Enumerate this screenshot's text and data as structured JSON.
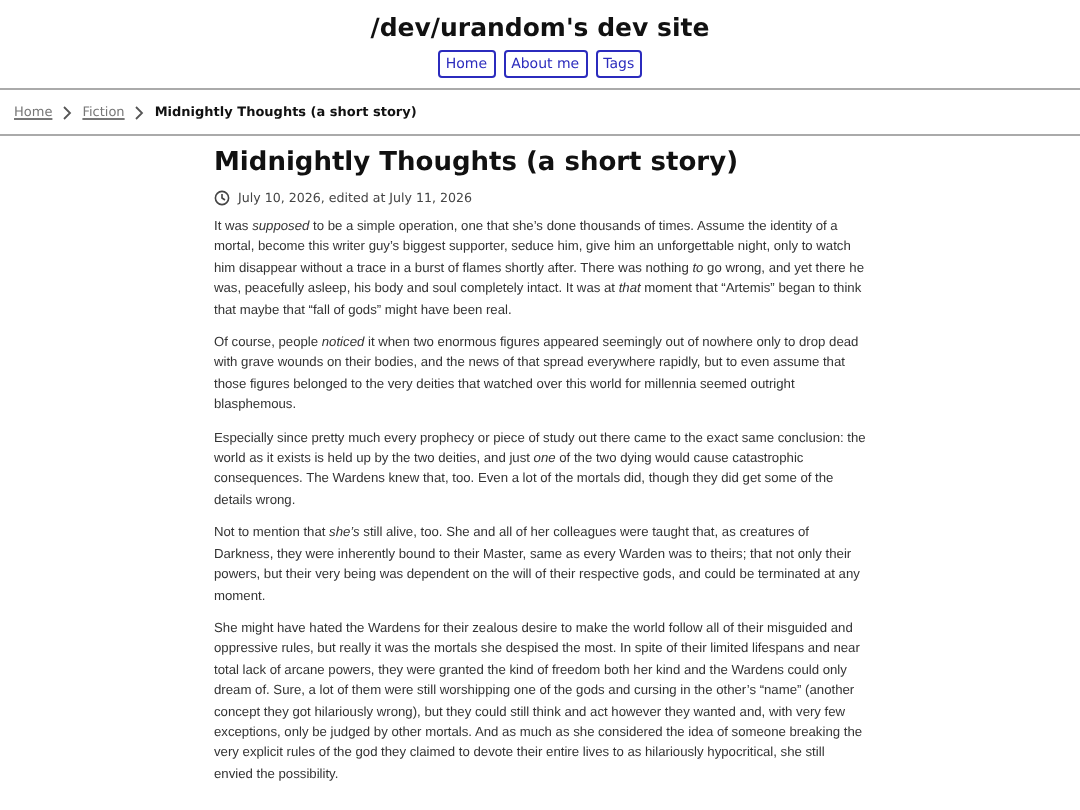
{
  "site_title": "/dev/urandom's dev site",
  "nav": [
    {
      "label": "Home"
    },
    {
      "label": "About me"
    },
    {
      "label": "Tags"
    }
  ],
  "breadcrumbs": [
    {
      "label": "Home",
      "kind": "link"
    },
    {
      "label": "Fiction",
      "kind": "link"
    },
    {
      "label": "Midnightly Thoughts (a short story)",
      "kind": "current"
    }
  ],
  "article": {
    "title": "Midnightly Thoughts (a short story)",
    "date": "July 10, 2026, edited at July 11, 2026",
    "paragraphs": [
      "It was *supposed* to be a simple operation, one that she’s done thousands of times. Assume the identity of a mortal, become this writer guy’s biggest supporter, seduce him, give him an unforgettable night, only to watch him disappear without a trace in a burst of flames shortly after. There was nothing *to* go wrong, and yet there he was, peacefully asleep, his body and soul completely intact. It was at *that* moment that “Artemis” began to think that maybe that “fall of gods” might have been real.",
      "Of course, people *noticed* it when two enormous figures appeared seemingly out of nowhere only to drop dead with grave wounds on their bodies, and the news of that spread everywhere rapidly, but to even assume that those figures belonged to the very deities that watched over this world for millennia seemed outright blasphemous.",
      "Especially since pretty much every prophecy or piece of study out there came to the exact same conclusion: the world as it exists is held up by the two deities, and just *one* of the two dying would cause catastrophic consequences. The Wardens knew that, too. Even a lot of the mortals did, though they did get some of the details wrong.",
      "Not to mention that *she’s* still alive, too. She and all of her colleagues were taught that, as creatures of Darkness, they were inherently bound to their Master, same as every Warden was to theirs; that not only their powers, but their very being was dependent on the will of their respective gods, and could be terminated at any moment.",
      "She might have hated the Wardens for their zealous desire to make the world follow all of their misguided and oppressive rules, but really it was the mortals she despised the most. In spite of their limited lifespans and near total lack of arcane powers, they were granted the kind of freedom both her kind and the Wardens could only dream of. Sure, a lot of them were still worshipping one of the gods and cursing in the other’s “name” (another concept they got hilariously wrong), but they could still think and act however they wanted and, with very few exceptions, only be judged by other mortals. And as much as she considered the idea of someone breaking the very explicit rules of the god they claimed to devote their entire lives to as hilariously hypocritical, she still envied the possibility."
    ]
  }
}
